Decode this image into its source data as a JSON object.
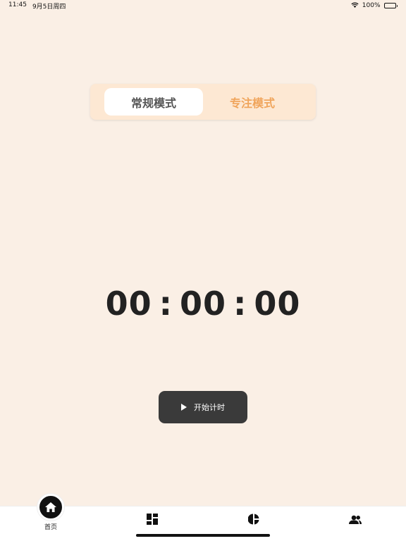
{
  "status_bar": {
    "time": "11:45",
    "date": "9月5日周四",
    "battery": "100%"
  },
  "mode_switch": {
    "tabs": [
      {
        "label": "常规模式",
        "selected": true
      },
      {
        "label": "专注模式",
        "selected": false
      }
    ]
  },
  "timer": {
    "hours": "00",
    "minutes": "00",
    "seconds": "00",
    "separator": ":"
  },
  "start_button": {
    "label": "开始计时"
  },
  "tab_bar": {
    "items": [
      {
        "label": "首页",
        "icon": "home-icon",
        "selected": true
      },
      {
        "label": "",
        "icon": "dashboard-icon",
        "selected": false
      },
      {
        "label": "",
        "icon": "pie-chart-icon",
        "selected": false
      },
      {
        "label": "",
        "icon": "people-icon",
        "selected": false
      }
    ]
  },
  "colors": {
    "background": "#FAEFE5",
    "accent": "#F0A55C",
    "button": "#3A3A3A"
  }
}
